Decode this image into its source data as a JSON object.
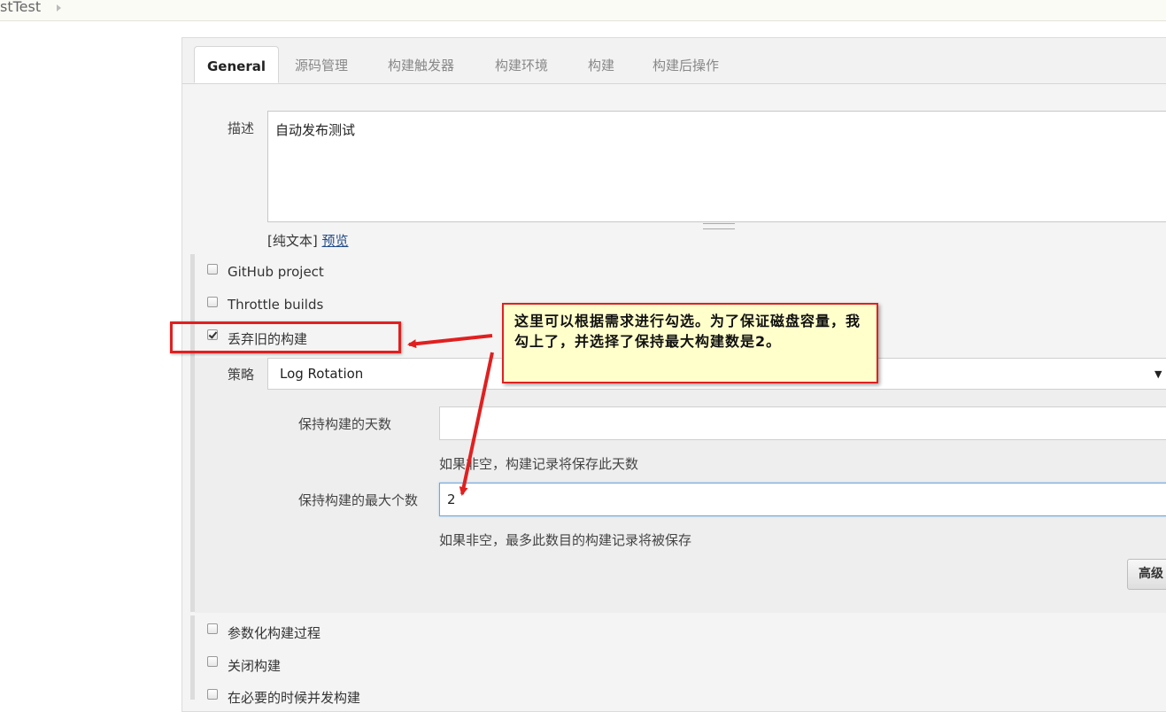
{
  "breadcrumb": {
    "project": "stTest"
  },
  "tabs": [
    {
      "label": "General",
      "active": true
    },
    {
      "label": "源码管理"
    },
    {
      "label": "构建触发器"
    },
    {
      "label": "构建环境"
    },
    {
      "label": "构建"
    },
    {
      "label": "构建后操作"
    }
  ],
  "description": {
    "label": "描述",
    "value": "自动发布测试",
    "format_label": "[纯文本]",
    "preview_link": "预览"
  },
  "options": {
    "github_project": {
      "label": "GitHub project",
      "checked": false
    },
    "throttle_builds": {
      "label": "Throttle builds",
      "checked": false
    },
    "discard_old_builds": {
      "label": "丢弃旧的构建",
      "checked": true
    },
    "parameterized": {
      "label": "参数化构建过程",
      "checked": false
    },
    "disable_build": {
      "label": "关闭构建",
      "checked": false
    },
    "concurrent_builds": {
      "label": "在必要的时候并发构建",
      "checked": false
    }
  },
  "strategy": {
    "label": "策略",
    "selected": "Log Rotation",
    "days_label": "保持构建的天数",
    "days_value": "",
    "days_hint": "如果非空，构建记录将保存此天数",
    "max_label": "保持构建的最大个数",
    "max_value": "2",
    "max_hint": "如果非空，最多此数目的构建记录将被保存",
    "advanced_button": "高级"
  },
  "annotation": {
    "text": "这里可以根据需求进行勾选。为了保证磁盘容量，我勾上了，并选择了保持最大构建数是2。",
    "color": "#e02020",
    "background": "#ffffcc"
  }
}
